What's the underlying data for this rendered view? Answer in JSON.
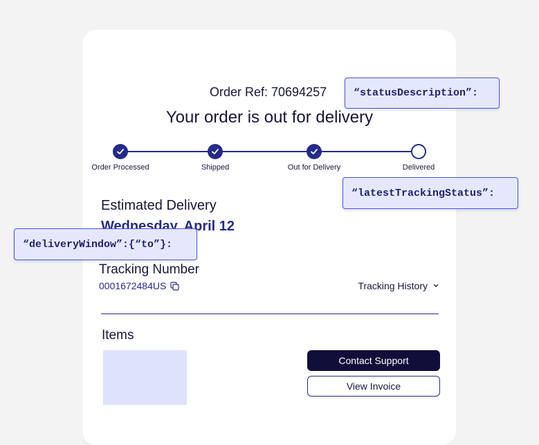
{
  "order": {
    "ref_text": "Order Ref: 70694257",
    "headline": "Your order is out for delivery"
  },
  "progress": {
    "steps": [
      {
        "label": "Order Processed",
        "state": "done"
      },
      {
        "label": "Shipped",
        "state": "done"
      },
      {
        "label": "Out for Delivery",
        "state": "done"
      },
      {
        "label": "Delivered",
        "state": "pending"
      }
    ]
  },
  "delivery": {
    "title": "Estimated Delivery",
    "date": "Wednesday, April 12"
  },
  "tracking": {
    "title": "Tracking Number",
    "number": "0001672484US",
    "history_label": "Tracking History"
  },
  "items": {
    "title": "Items"
  },
  "actions": {
    "contact_support": "Contact Support",
    "view_invoice": "View Invoice"
  },
  "annotations": {
    "status_description": "“statusDescription”:",
    "latest_tracking_status": "“latestTrackingStatus”:",
    "delivery_window_to": "“deliveryWindow”:{“to”}:"
  },
  "colors": {
    "page_bg": "#f3f3f4",
    "card_bg": "#ffffff",
    "brand_navy": "#242b8a",
    "dark_button": "#120e3a",
    "annotation_bg": "#e5e8fd",
    "annotation_border": "#4a56e0",
    "thumb_bg": "#dfe2fb"
  },
  "icons": {
    "step_done": "check-icon",
    "copy": "copy-icon",
    "expand": "chevron-down-icon"
  }
}
